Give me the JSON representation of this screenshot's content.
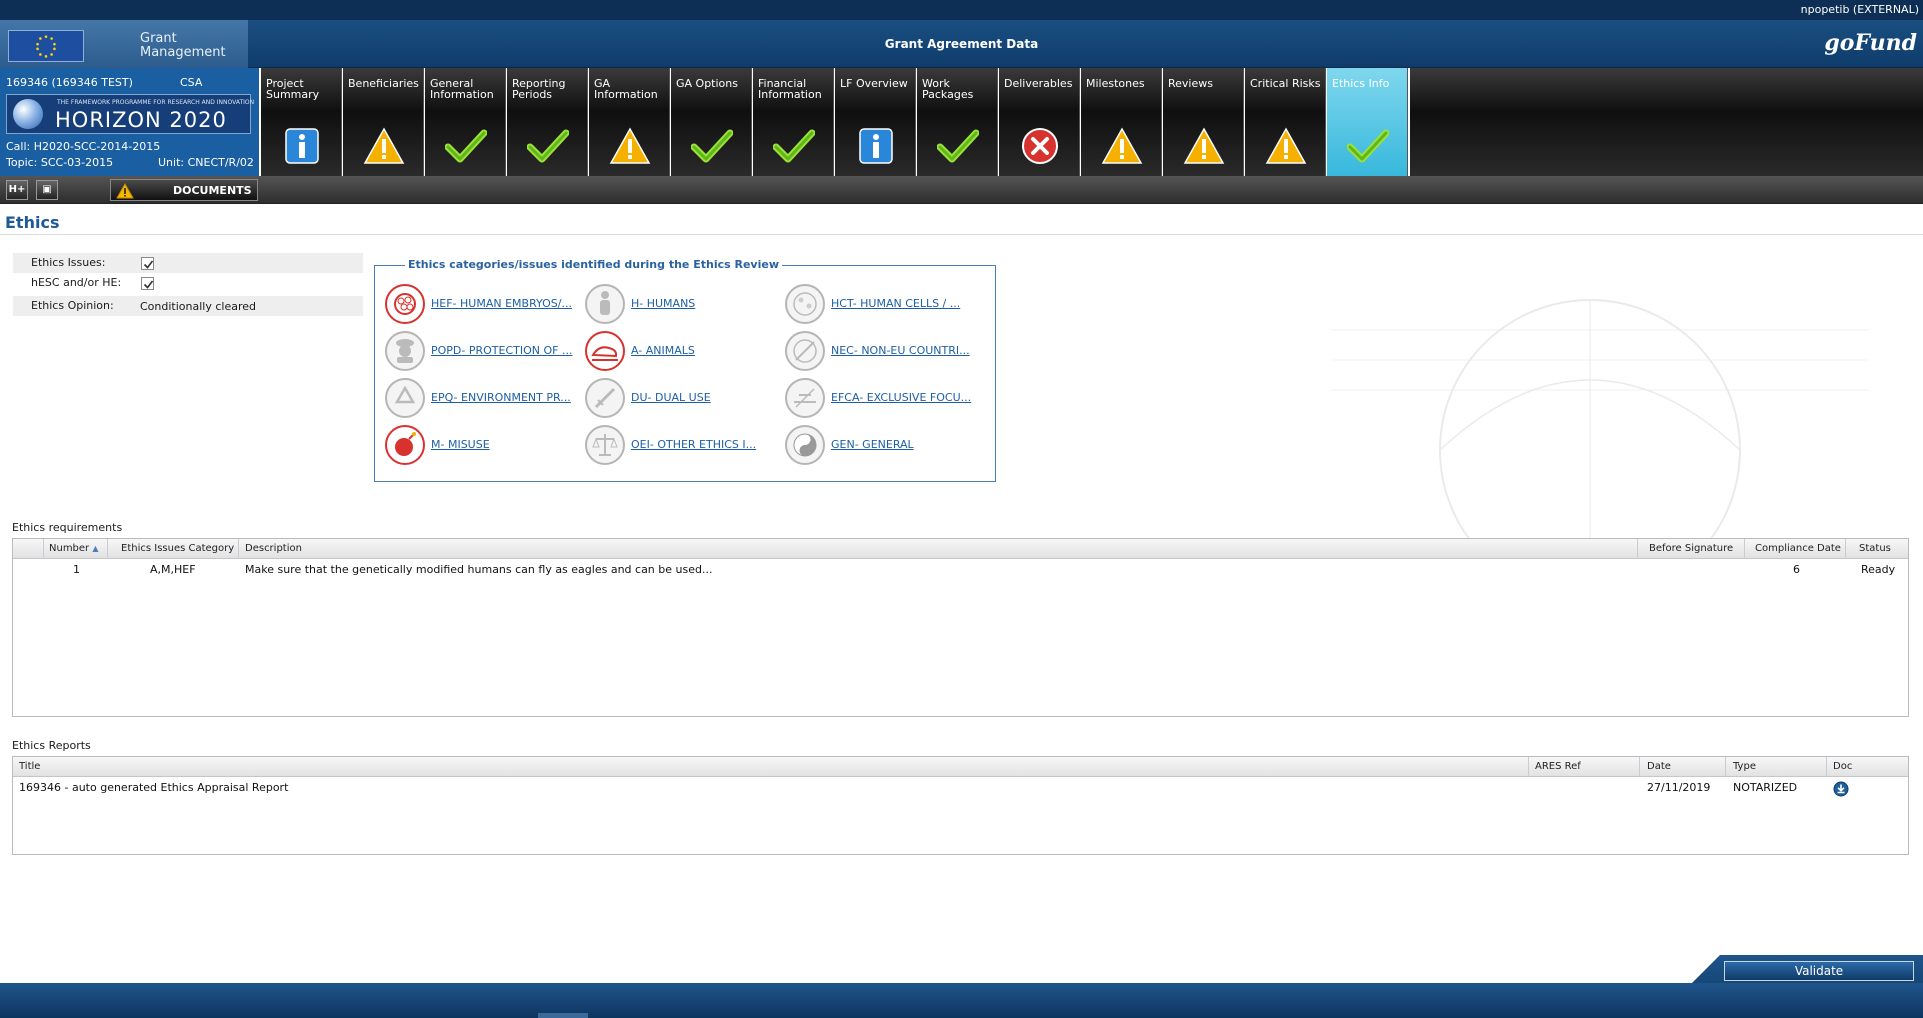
{
  "topbar": {
    "user": "npopetib (EXTERNAL)"
  },
  "header": {
    "brand": [
      "Grant",
      "Management"
    ],
    "title": "Grant Agreement Data",
    "logo_text": "goFund"
  },
  "project": {
    "id": "169346 (169346 TEST)",
    "type": "CSA",
    "programme_small": "THE FRAMEWORK PROGRAMME FOR RESEARCH AND INNOVATION",
    "programme": "HORIZON 2020",
    "call": "Call: H2020-SCC-2014-2015",
    "topic": "Topic: SCC-03-2015",
    "unit": "Unit: CNECT/R/02"
  },
  "tabs": [
    {
      "label": "Project Summary",
      "status": "info"
    },
    {
      "label": "Beneficiaries",
      "status": "warning"
    },
    {
      "label": "General Information",
      "status": "ok"
    },
    {
      "label": "Reporting Periods",
      "status": "ok"
    },
    {
      "label": "GA Information",
      "status": "warning"
    },
    {
      "label": "GA Options",
      "status": "ok"
    },
    {
      "label": "Financial Information",
      "status": "ok"
    },
    {
      "label": "LF Overview",
      "status": "info"
    },
    {
      "label": "Work Packages",
      "status": "ok"
    },
    {
      "label": "Deliverables",
      "status": "error"
    },
    {
      "label": "Milestones",
      "status": "warning"
    },
    {
      "label": "Reviews",
      "status": "warning"
    },
    {
      "label": "Critical Risks",
      "status": "warning"
    },
    {
      "label": "Ethics Info",
      "status": "ok",
      "active": true
    }
  ],
  "toolbar": {
    "btn1": "H+",
    "btn2": "▣",
    "documents": "DOCUMENTS"
  },
  "page": {
    "title": "Ethics"
  },
  "ethics": {
    "issues_label": "Ethics Issues:",
    "issues_checked": true,
    "hesc_label": "hESC and/or HE:",
    "hesc_checked": true,
    "opinion_label": "Ethics Opinion:",
    "opinion_value": "Conditionally cleared"
  },
  "categories": {
    "legend": "Ethics categories/issues identified during the Ethics Review",
    "items": [
      {
        "label": "HEF- HUMAN EMBRYOS/...",
        "active": true,
        "icon": "embryo-icon"
      },
      {
        "label": "H- HUMANS",
        "active": false,
        "icon": "human-icon"
      },
      {
        "label": "HCT- HUMAN CELLS / ...",
        "active": false,
        "icon": "cells-icon"
      },
      {
        "label": "POPD- PROTECTION OF ...",
        "active": false,
        "icon": "spy-icon"
      },
      {
        "label": "A- ANIMALS",
        "active": true,
        "icon": "animal-icon"
      },
      {
        "label": "NEC- NON-EU COUNTRI...",
        "active": false,
        "icon": "globe-icon"
      },
      {
        "label": "EPQ- ENVIRONMENT PR...",
        "active": false,
        "icon": "recycle-icon"
      },
      {
        "label": "DU- DUAL USE",
        "active": false,
        "icon": "sword-icon"
      },
      {
        "label": "EFCA- EXCLUSIVE FOCU...",
        "active": false,
        "icon": "exclusive-icon"
      },
      {
        "label": "M- MISUSE",
        "active": true,
        "icon": "bomb-icon"
      },
      {
        "label": "OEI- OTHER ETHICS I...",
        "active": false,
        "icon": "scales-icon"
      },
      {
        "label": "GEN- GENERAL",
        "active": false,
        "icon": "yinyang-icon"
      }
    ]
  },
  "requirements": {
    "section": "Ethics requirements",
    "columns": [
      "Number",
      "Ethics Issues Category",
      "Description",
      "Before Signature",
      "Compliance Date",
      "Status"
    ],
    "sort_icon": "▲",
    "rows": [
      {
        "number": "1",
        "category": "A,M,HEF",
        "description": "Make sure that the genetically modified humans can fly as eagles and can be used...",
        "before_signature": "",
        "compliance_date": "6",
        "status": "Ready"
      }
    ]
  },
  "reports": {
    "section": "Ethics Reports",
    "columns": [
      "Title",
      "ARES Ref",
      "Date",
      "Type",
      "Doc"
    ],
    "rows": [
      {
        "title": "169346 - auto generated Ethics Appraisal Report",
        "ares": "",
        "date": "27/11/2019",
        "type": "NOTARIZED"
      }
    ]
  },
  "footer": {
    "validate": "Validate"
  },
  "colors": {
    "brand_blue": "#1b5fa3",
    "link": "#1d5fa5",
    "active_tab": "#38b8dc",
    "error_red": "#d8322e"
  }
}
